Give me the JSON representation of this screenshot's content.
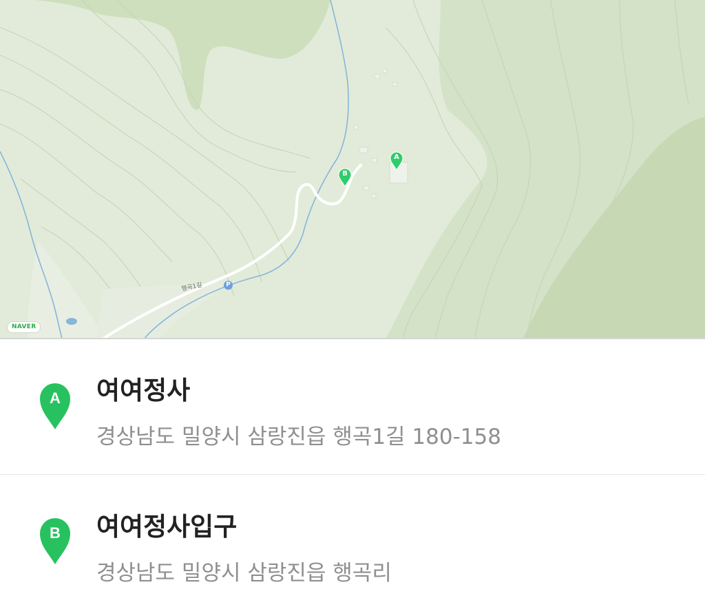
{
  "map": {
    "provider_logo": "NAVER",
    "road_label": "행곡1길",
    "parking_symbol": "P",
    "pins": [
      {
        "label": "A",
        "color": "#2ecc6a"
      },
      {
        "label": "B",
        "color": "#2ecc6a"
      }
    ],
    "colors": {
      "land_light": "#e3ecdb",
      "land_mid": "#d7e4cc",
      "land_dark": "#c8dab7",
      "river": "#7fb2d8",
      "road": "#ffffff"
    }
  },
  "places": [
    {
      "marker": "A",
      "name": "여여정사",
      "address": "경상남도 밀양시 삼랑진읍 행곡1길 180-158"
    },
    {
      "marker": "B",
      "name": "여여정사입구",
      "address": "경상남도 밀양시 삼랑진읍 행곡리"
    }
  ],
  "accent_color": "#27c25f"
}
